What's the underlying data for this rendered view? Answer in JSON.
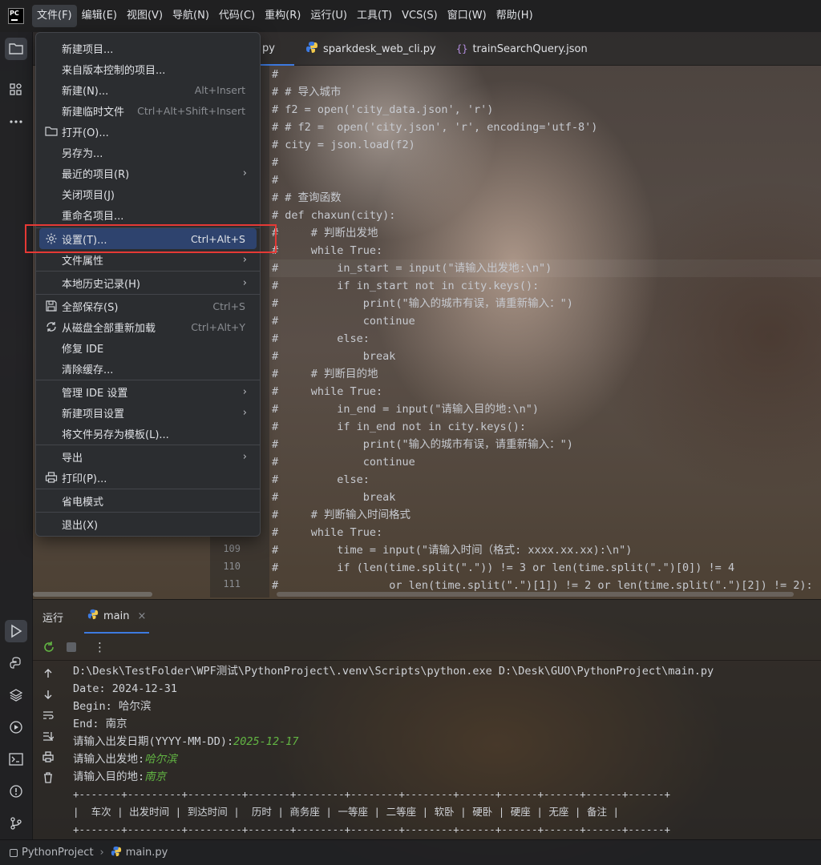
{
  "menubar": {
    "logo_text": "PC",
    "items": [
      "文件(F)",
      "编辑(E)",
      "视图(V)",
      "导航(N)",
      "代码(C)",
      "重构(R)",
      "运行(U)",
      "工具(T)",
      "VCS(S)",
      "窗口(W)",
      "帮助(H)"
    ]
  },
  "tabs": [
    {
      "label": "py"
    },
    {
      "label": "sparkdesk_web_cli.py"
    },
    {
      "label": "trainSearchQuery.json"
    }
  ],
  "file_menu": {
    "items": [
      {
        "label": "新建项目..."
      },
      {
        "label": "来自版本控制的项目..."
      },
      {
        "label": "新建(N)...",
        "shortcut": "Alt+Insert"
      },
      {
        "label": "新建临时文件",
        "shortcut": "Ctrl+Alt+Shift+Insert"
      },
      {
        "label": "打开(O)...",
        "icon": "folder-icon"
      },
      {
        "label": "另存为..."
      },
      {
        "label": "最近的项目(R)",
        "submenu": true
      },
      {
        "label": "关闭项目(J)"
      },
      {
        "label": "重命名项目..."
      },
      {
        "label": "设置(T)...",
        "shortcut": "Ctrl+Alt+S",
        "icon": "gear-icon",
        "selected": true
      },
      {
        "label": "文件属性",
        "submenu": true
      },
      {
        "label": "本地历史记录(H)",
        "submenu": true
      },
      {
        "label": "全部保存(S)",
        "shortcut": "Ctrl+S",
        "icon": "save-icon"
      },
      {
        "label": "从磁盘全部重新加载",
        "shortcut": "Ctrl+Alt+Y",
        "icon": "reload-icon"
      },
      {
        "label": "修复 IDE"
      },
      {
        "label": "清除缓存..."
      },
      {
        "label": "管理 IDE 设置",
        "submenu": true
      },
      {
        "label": "新建项目设置",
        "submenu": true
      },
      {
        "label": "将文件另存为模板(L)..."
      },
      {
        "label": "导出",
        "submenu": true
      },
      {
        "label": "打印(P)...",
        "icon": "print-icon"
      },
      {
        "label": "省电模式"
      },
      {
        "label": "退出(X)"
      }
    ],
    "submenu_arrow": "›"
  },
  "gutter": {
    "line_numbers": [
      "109",
      "110",
      "111"
    ]
  },
  "code_lines": [
    "#",
    "# # 导入城市",
    "# f2 = open('city_data.json', 'r')",
    "# # f2 =  open('city.json', 'r', encoding='utf-8')",
    "# city = json.load(f2)",
    "#",
    "#",
    "# # 查询函数",
    "# def chaxun(city):",
    "#     # 判断出发地",
    "#     while True:",
    "#         in_start = input(\"请输入出发地:\\n\")",
    "#         if in_start not in city.keys():",
    "#             print(\"输入的城市有误，请重新输入：\")",
    "#             continue",
    "#         else:",
    "#             break",
    "#     # 判断目的地",
    "#     while True:",
    "#         in_end = input(\"请输入目的地:\\n\")",
    "#         if in_end not in city.keys():",
    "#             print(\"输入的城市有误，请重新输入：\")",
    "#             continue",
    "#         else:",
    "#             break",
    "#     # 判断输入时间格式",
    "#     while True:",
    "#         time = input(\"请输入时间（格式: xxxx.xx.xx):\\n\")",
    "#         if (len(time.split(\".\")) != 3 or len(time.split(\".\")[0]) != 4",
    "#                 or len(time.split(\".\")[1]) != 2 or len(time.split(\".\")[2]) != 2):"
  ],
  "run_panel": {
    "title": "运行",
    "tab_label": "main",
    "close_glyph": "×",
    "more_glyph": "⋮"
  },
  "console": {
    "lines": [
      {
        "text": "D:\\Desk\\TestFolder\\WPF测试\\PythonProject\\.venv\\Scripts\\python.exe D:\\Desk\\GUO\\PythonProject\\main.py"
      },
      {
        "text": "Date: 2024-12-31"
      },
      {
        "text": "Begin: 哈尔滨"
      },
      {
        "text": "End: 南京"
      },
      {
        "text": "请输入出发日期(YYYY-MM-DD):",
        "input": "2025-12-17"
      },
      {
        "text": "请输入出发地:",
        "input": "哈尔滨"
      },
      {
        "text": "请输入目的地:",
        "input": "南京"
      },
      {
        "text": "+-------+---------+---------+-------+--------+--------+--------+------+------+------+------+------+"
      },
      {
        "text": "|  车次 | 出发时间 | 到达时间 |  历时 | 商务座 | 一等座 | 二等座 | 软卧 | 硬卧 | 硬座 | 无座 | 备注 |"
      },
      {
        "text": "+-------+---------+---------+-------+--------+--------+--------+------+------+------+------+------+"
      }
    ]
  },
  "statusbar": {
    "project": "PythonProject",
    "separator": "›",
    "file": "main.py"
  },
  "colors": {
    "accent": "#3d7ae0",
    "selection": "#2e436e",
    "highlight_box": "#e53935",
    "console_input": "#62b543"
  }
}
